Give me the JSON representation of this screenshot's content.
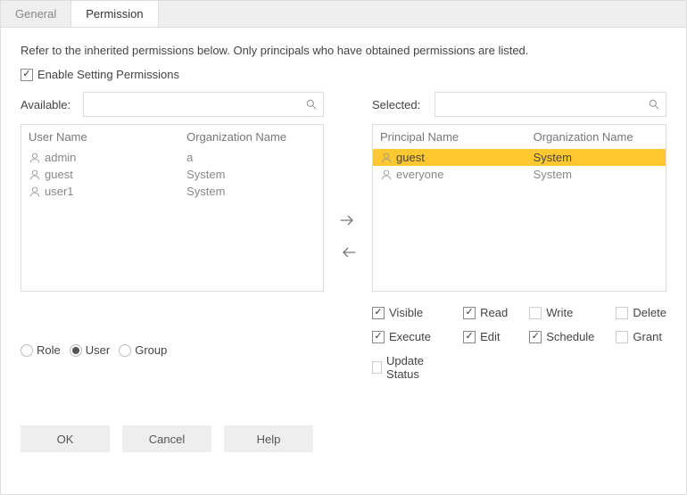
{
  "tabs": {
    "general": "General",
    "permission": "Permission"
  },
  "intro": "Refer to the inherited permissions below. Only principals who have obtained permissions are listed.",
  "enable_label": "Enable Setting Permissions",
  "enable_checked": true,
  "available": {
    "label": "Available:",
    "search_placeholder": "",
    "headers": {
      "name": "User Name",
      "org": "Organization Name"
    },
    "rows": [
      {
        "name": "admin",
        "org": "a"
      },
      {
        "name": "guest",
        "org": "System"
      },
      {
        "name": "user1",
        "org": "System"
      }
    ]
  },
  "selected": {
    "label": "Selected:",
    "search_placeholder": "",
    "headers": {
      "name": "Principal Name",
      "org": "Organization Name"
    },
    "rows": [
      {
        "name": "guest",
        "org": "System",
        "selected": true
      },
      {
        "name": "everyone",
        "org": "System",
        "selected": false
      }
    ]
  },
  "principal_type": {
    "options": {
      "role": "Role",
      "user": "User",
      "group": "Group"
    },
    "value": "user"
  },
  "permissions": [
    {
      "key": "visible",
      "label": "Visible",
      "checked": true
    },
    {
      "key": "read",
      "label": "Read",
      "checked": true
    },
    {
      "key": "write",
      "label": "Write",
      "checked": false
    },
    {
      "key": "delete",
      "label": "Delete",
      "checked": false
    },
    {
      "key": "execute",
      "label": "Execute",
      "checked": true
    },
    {
      "key": "edit",
      "label": "Edit",
      "checked": true
    },
    {
      "key": "schedule",
      "label": "Schedule",
      "checked": true
    },
    {
      "key": "grant",
      "label": "Grant",
      "checked": false
    },
    {
      "key": "update_status",
      "label": "Update Status",
      "checked": false
    }
  ],
  "buttons": {
    "ok": "OK",
    "cancel": "Cancel",
    "help": "Help"
  }
}
